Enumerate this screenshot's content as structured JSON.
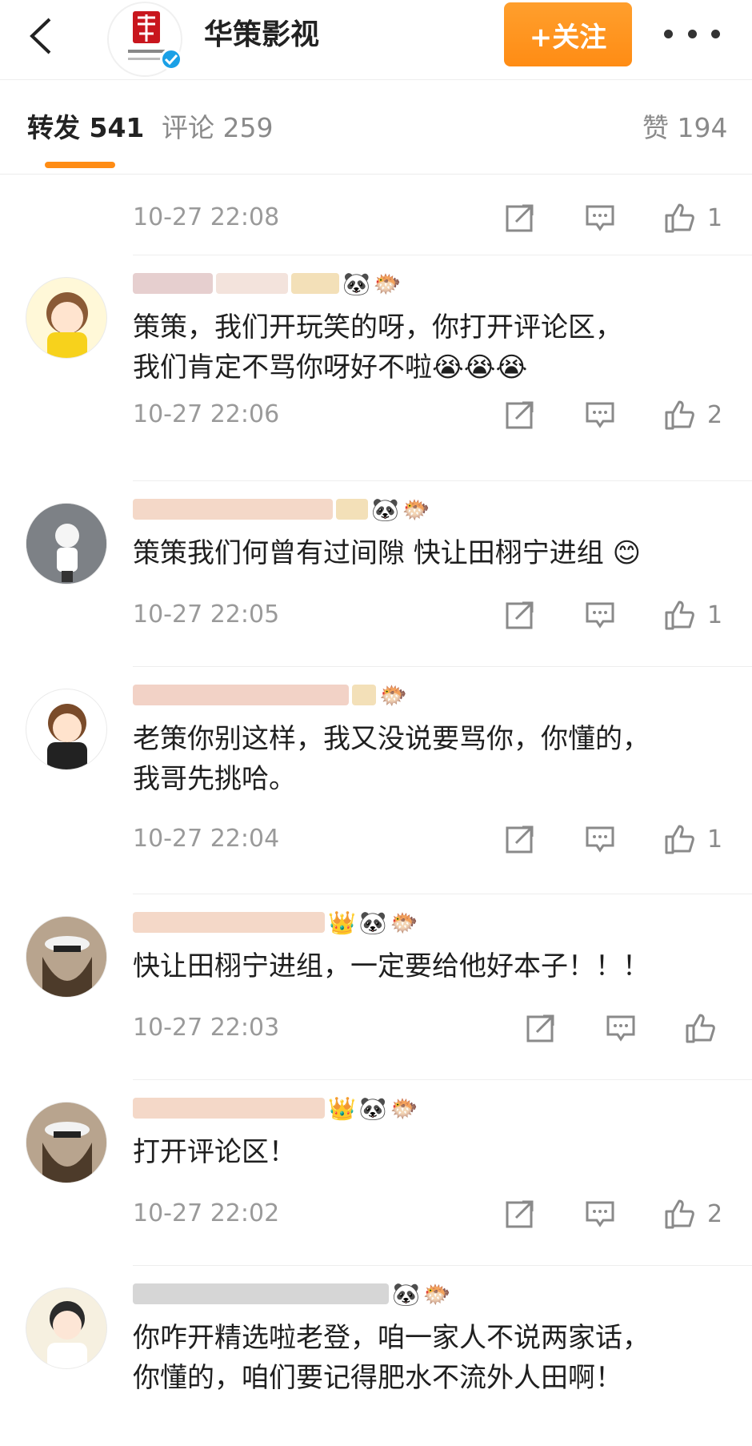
{
  "header": {
    "back_icon": "chevron-left-icon",
    "account_name": "华策影视",
    "follow_label": "+关注",
    "more_icon": "more-dots-icon",
    "verified_icon": "verified-badge-icon",
    "brand_color": "#ff8c14"
  },
  "tabs": {
    "repost": "转发 541",
    "comment": "评论 259",
    "like": "赞 194"
  },
  "comments": [
    {
      "text": "",
      "time": "10-27 22:08",
      "likes": "1"
    },
    {
      "text_line1": "策策，我们开玩笑的呀，你打开评论区，",
      "text_line2": "我们肯定不骂你呀好不啦",
      "time": "10-27 22:06",
      "likes": "2"
    },
    {
      "text_line1": "策策我们何曾有过间隙 快让田栩宁进组",
      "time": "10-27 22:05",
      "likes": "1"
    },
    {
      "text_line1": "老策你别这样，我又没说要骂你，你懂的，",
      "text_line2": "我哥先挑哈。",
      "time": "10-27 22:04",
      "likes": "1"
    },
    {
      "text_line1": "快让田栩宁进组，一定要给他好本子！！！",
      "time": "10-27 22:03",
      "likes": ""
    },
    {
      "text_line1": "打开评论区！",
      "time": "10-27 22:02",
      "likes": "2"
    },
    {
      "text_line1": "你咋开精选啦老登，咱一家人不说两家话，",
      "text_line2": "你懂的，咱们要记得肥水不流外人田啊！"
    }
  ],
  "icons": {
    "share": "share-external-icon",
    "comment": "comment-bubble-icon",
    "like": "thumbs-up-icon"
  }
}
